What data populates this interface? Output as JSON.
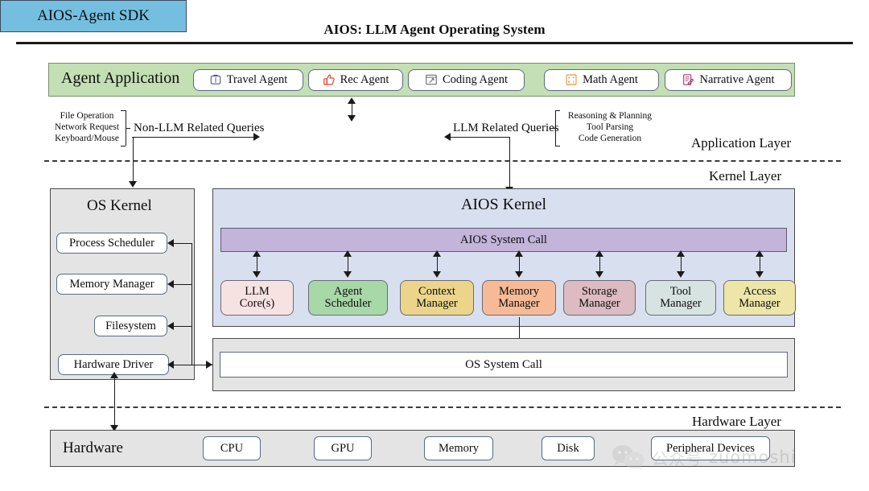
{
  "title": "AIOS: LLM Agent Operating System",
  "application_layer": {
    "layer_label": "Application Layer",
    "agent_application": {
      "title": "Agent Application",
      "agents": [
        {
          "label": "Travel Agent",
          "icon": "suitcase-icon",
          "icon_color": "#4a5b8c"
        },
        {
          "label": "Rec Agent",
          "icon": "thumbs-up-icon",
          "icon_color": "#e23b25"
        },
        {
          "label": "Coding Agent",
          "icon": "code-window-icon",
          "icon_color": "#6e6e6e"
        },
        {
          "label": "Math Agent",
          "icon": "calculator-icon",
          "icon_color": "#e8943a"
        },
        {
          "label": "Narrative Agent",
          "icon": "document-pen-icon",
          "icon_color": "#a23b6d"
        }
      ]
    },
    "sdk": {
      "label": "AIOS-Agent SDK",
      "color": "#74bfe0"
    },
    "left_queries": {
      "edge_label": "Non-LLM Related Queries",
      "items": [
        "File Operation",
        "Network Request",
        "Keyboard/Mouse"
      ]
    },
    "right_queries": {
      "edge_label": "LLM Related Queries",
      "items": [
        "Reasoning & Planning",
        "Tool Parsing",
        "Code Generation"
      ]
    }
  },
  "kernel_layer": {
    "layer_label": "Kernel Layer",
    "os_kernel": {
      "title": "OS Kernel",
      "items": [
        "Process Scheduler",
        "Memory Manager",
        "Filesystem",
        "Hardware Driver"
      ]
    },
    "aios_kernel": {
      "title": "AIOS Kernel",
      "system_call": {
        "label": "AIOS System Call",
        "color": "#c3b4d9"
      },
      "modules": [
        {
          "line1": "LLM",
          "line2": "Core(s)",
          "color": "#f7e2e2"
        },
        {
          "line1": "Agent",
          "line2": "Scheduler",
          "color": "#a8d8a8"
        },
        {
          "line1": "Context",
          "line2": "Manager",
          "color": "#ecd58a"
        },
        {
          "line1": "Memory",
          "line2": "Manager",
          "color": "#f6bb96"
        },
        {
          "line1": "Storage",
          "line2": "Manager",
          "color": "#dcbcc0"
        },
        {
          "line1": "Tool",
          "line2": "Manager",
          "color": "#d6e3e1"
        },
        {
          "line1": "Access",
          "line2": "Manager",
          "color": "#eee6a8"
        }
      ]
    },
    "os_system_call": {
      "label": "OS System Call"
    }
  },
  "hardware_layer": {
    "layer_label": "Hardware Layer",
    "title": "Hardware",
    "items": [
      "CPU",
      "GPU",
      "Memory",
      "Disk",
      "Peripheral Devices"
    ]
  },
  "watermark": {
    "cn": "公众号",
    "text": "zuomoshi"
  }
}
